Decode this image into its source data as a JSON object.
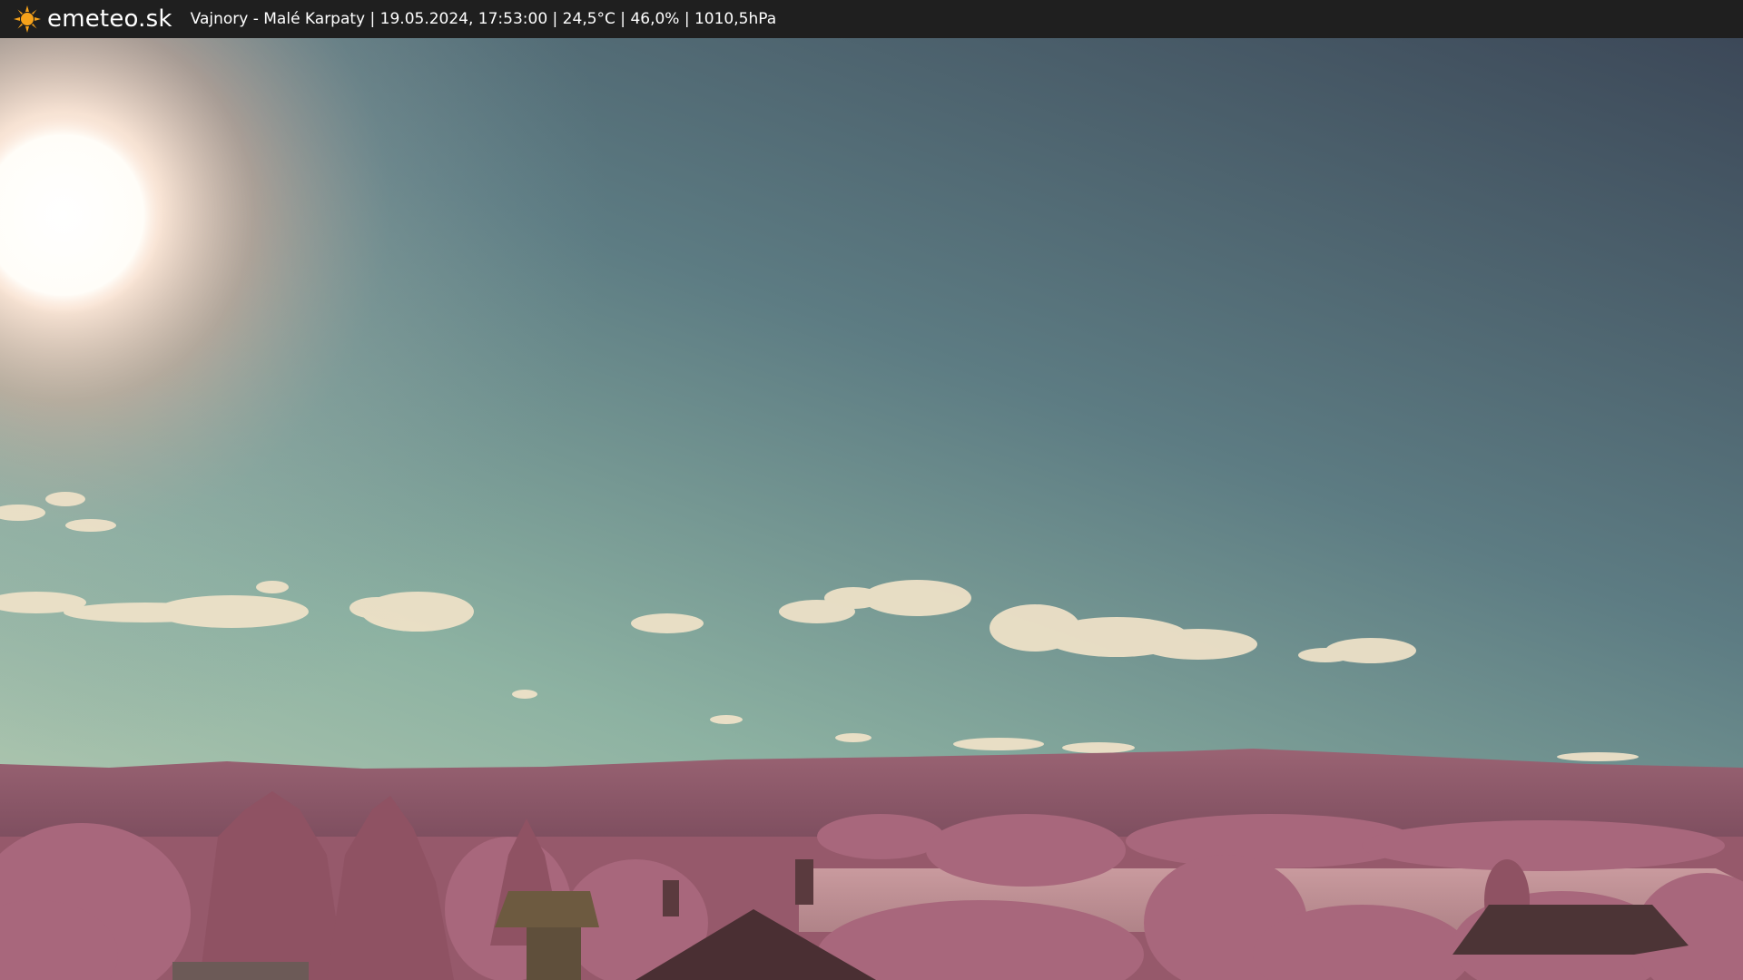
{
  "header": {
    "brand": "emeteo.sk",
    "info": "Vajnory - Malé Karpaty | 19.05.2024, 17:53:00 | 24,5°C | 46,0% | 1010,5hPa",
    "logo_icon": "sun-icon"
  },
  "scene": {
    "sky_top": "#3f4c5a",
    "sky_bottom": "#9bb9a7",
    "vegetation": "#a8677c",
    "hills": "#8c5667"
  }
}
